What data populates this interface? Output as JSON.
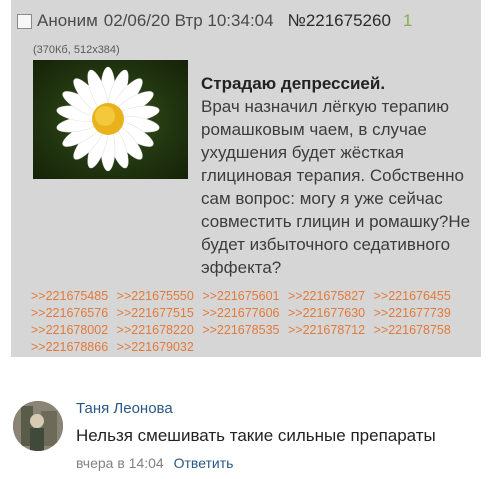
{
  "post": {
    "author": "Аноним",
    "datetime": "02/06/20 Втр 10:34:04",
    "post_number": "№221675260",
    "reply_count": "1",
    "file_info": "(370Кб, 512x384)",
    "subject": "Страдаю депрессией.",
    "body": "Врач назначил лёгкую терапию ромашковым чаем, в случае ухудшения будет жёсткая глициновая терапия. Собственно сам вопрос: могу я уже сейчас совместить глицин и ромашку?Не будет избыточного седативного эффекта?",
    "replies": [
      ">>221675485",
      ">>221675550",
      ">>221675601",
      ">>221675827",
      ">>221676455",
      ">>221676576",
      ">>221677515",
      ">>221677606",
      ">>221677630",
      ">>221677739",
      ">>221678002",
      ">>221678220",
      ">>221678535",
      ">>221678712",
      ">>221678758",
      ">>221678866",
      ">>221679032"
    ]
  },
  "comment": {
    "name": "Таня Леонова",
    "text": "Нельзя смешивать такие сильные препараты",
    "time": "вчера в 14:04",
    "reply_label": "Ответить"
  }
}
